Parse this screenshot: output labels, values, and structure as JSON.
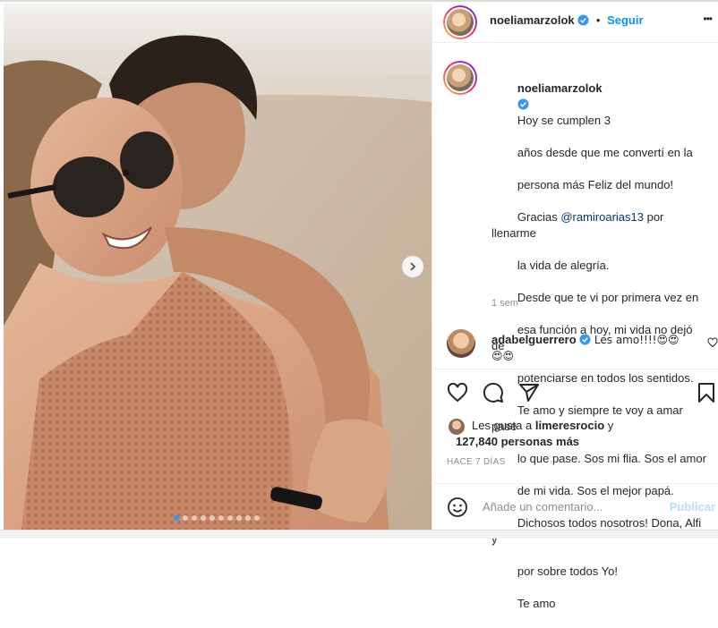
{
  "post": {
    "username": "noeliamarzolok",
    "follow_separator": "•",
    "follow_label": "Seguir",
    "more_label": "•••",
    "carousel": {
      "slides": 10,
      "active_index": 0
    }
  },
  "caption": {
    "username": "noeliamarzolok",
    "lines": [
      "Hoy se cumplen 3",
      "años desde que me convertí en la",
      "persona más Feliz del mundo!",
      "Gracias ",
      "@ramiroarias13",
      " por llenarme",
      "la vida de alegría.",
      "Desde que te vi por primera vez en",
      "esa función a hoy, mi vida no dejó de",
      "potenciarse en todos los sentidos.",
      "Te amo y siempre te voy a amar pase",
      "lo que pase. Sos mi flia. Sos el amor",
      "de mi vida. Sos el mejor papá.",
      "Dichosos todos nosotros! Dona, Alfi y",
      "por sobre todos Yo!",
      "Te amo"
    ],
    "time": "1 sem"
  },
  "comment": {
    "username": "adabelguerrero",
    "text_line1": "Les amo!!!!😍😍",
    "text_line2": "😍😍"
  },
  "likes": {
    "prefix": "Les gusta a ",
    "first_user": "limeresrocio",
    "conjunction": " y",
    "count": "127,840 personas más",
    "posted_ago": "HACE 7 DÍAS"
  },
  "comment_input": {
    "placeholder": "Añade un comentario...",
    "publish_label": "Publicar"
  },
  "colors": {
    "link": "#0095f6",
    "verified": "#3897f0",
    "muted": "#8e8e8e",
    "mention": "#00376b"
  },
  "icons": {
    "header_more": "more-horizontal-icon",
    "verified": "verified-badge-icon",
    "like": "heart-icon",
    "comment": "comment-bubble-icon",
    "share": "paper-plane-icon",
    "save": "bookmark-icon",
    "emoji": "smiley-icon",
    "comment_like": "small-heart-icon",
    "next": "chevron-right-icon"
  }
}
